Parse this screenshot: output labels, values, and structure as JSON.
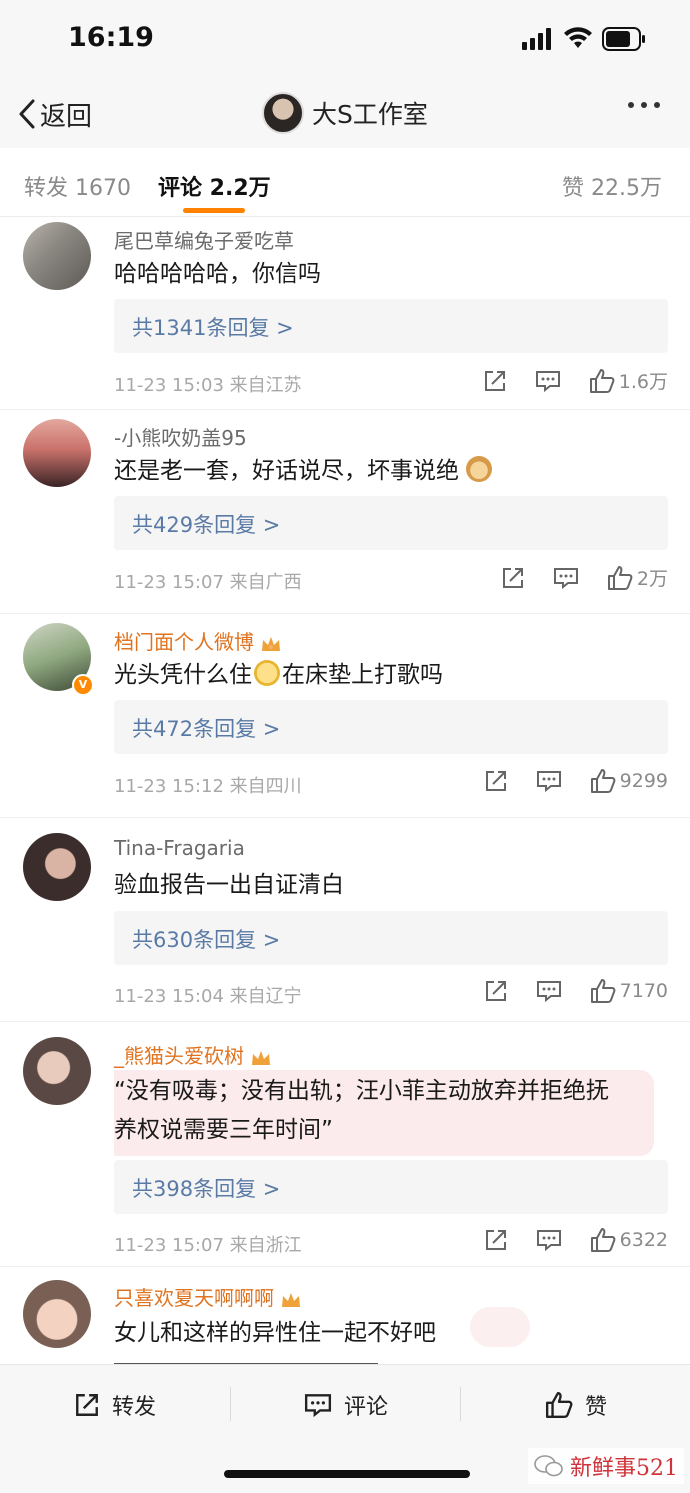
{
  "status_bar": {
    "time": "16:19"
  },
  "nav": {
    "back_label": "返回",
    "title": "大S工作室"
  },
  "tabs": {
    "repost": "转发 1670",
    "comments": "评论 2.2万",
    "likes": "赞 22.5万"
  },
  "comments": [
    {
      "name": "尾巴草编兔子爱吃草",
      "text": "哈哈哈哈哈，你信吗",
      "replies": "共1341条回复 >",
      "meta": "11-23 15:03 来自江苏",
      "likes": "1.6万"
    },
    {
      "name": "-小熊吹奶盖95",
      "text": "还是老一套，好话说尽，坏事说绝",
      "replies": "共429条回复 >",
      "meta": "11-23 15:07 来自广西",
      "likes": "2万"
    },
    {
      "name": "档门面个人微博",
      "text_a": "光头凭什么住",
      "text_b": "在床垫上打歌吗",
      "replies": "共472条回复 >",
      "meta": "11-23 15:12 来自四川",
      "likes": "9299"
    },
    {
      "name": "Tina-Fragaria",
      "text": "验血报告一出自证清白",
      "replies": "共630条回复 >",
      "meta": "11-23 15:04 来自辽宁",
      "likes": "7170"
    },
    {
      "name": "_熊猫头爱砍树",
      "text_line1": "“没有吸毒；没有出轨；汪小菲主动放弃并拒绝抚",
      "text_line2": "养权说需要三年时间”",
      "replies": "共398条回复 >",
      "meta": "11-23 15:07 来自浙江",
      "likes": "6322"
    },
    {
      "name": "只喜欢夏天啊啊啊",
      "text": "女儿和这样的异性住一起不好吧"
    }
  ],
  "bottom_bar": {
    "repost": "转发",
    "comment": "评论",
    "like": "赞"
  },
  "watermark": "新鲜事521",
  "colors": {
    "accent": "#ff8200",
    "vip_name": "#e0731f",
    "reply_link": "#5a7aa6"
  }
}
